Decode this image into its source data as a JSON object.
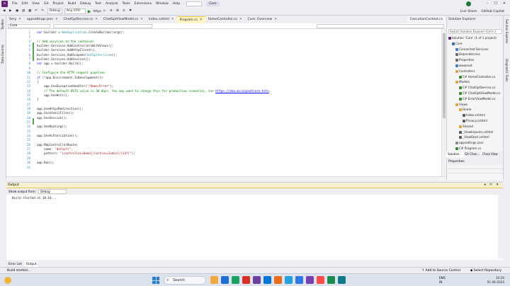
{
  "menu": {
    "items": [
      "File",
      "Edit",
      "View",
      "Git",
      "Project",
      "Build",
      "Debug",
      "Test",
      "Analyze",
      "Tools",
      "Extensions",
      "Window",
      "Help"
    ],
    "solution_badge": "Core",
    "avatar_initial": "S"
  },
  "toolbar": {
    "config": "Debug",
    "platform": "Any CPU",
    "run_target": "https",
    "live_share": "Live Share",
    "copilot": "GitHub Copilot"
  },
  "side_strips": {
    "left": [
      "Toolbox",
      "Data Sources"
    ],
    "right": [
      "Solution Explorer",
      "Diagnostic Tools"
    ]
  },
  "tabs": [
    {
      "label": "Sery",
      "active": false
    },
    {
      "label": "appsettings.json",
      "active": false
    },
    {
      "label": "ChatGptService.cs",
      "active": false
    },
    {
      "label": "ChatGptViewModel.cs",
      "active": false
    },
    {
      "label": "Index.cshtml",
      "active": false
    },
    {
      "label": "Program.cs",
      "active": true
    },
    {
      "label": "HomeController.cs",
      "active": false
    },
    {
      "label": "Core: Overview",
      "active": false
    }
  ],
  "right_tab": "ExecutionContext.cs",
  "navbar": {
    "project": "Core",
    "scope": ""
  },
  "code_lines": [
    {
      "n": "1",
      "html": "<span class=\"kw\">var</span> builder = <span class=\"ty\">WebApplication</span>.CreateBuilder(args);"
    },
    {
      "n": "2",
      "html": ""
    },
    {
      "n": "3",
      "html": "<span class=\"cm\">// Add services to the container.</span>"
    },
    {
      "n": "4",
      "html": "builder.Services.AddControllersWithViews();"
    },
    {
      "n": "5",
      "html": "builder.Services.AddHttpClient();"
    },
    {
      "n": "6",
      "html": "builder.Services.AddScoped&lt;<span class=\"ty\">ChatGptService</span>&gt;();"
    },
    {
      "n": "7",
      "html": "builder.Services.AddSession();"
    },
    {
      "n": "8",
      "html": "<span class=\"kw\">var</span> app = builder.Build();"
    },
    {
      "n": "9",
      "html": ""
    },
    {
      "n": "10",
      "html": "<span class=\"cm\">// Configure the HTTP request pipeline.</span>"
    },
    {
      "n": "11",
      "html": "<span class=\"kw\">if</span> (!app.Environment.IsDevelopment())"
    },
    {
      "n": "12",
      "html": "{"
    },
    {
      "n": "13",
      "html": "    app.UseExceptionHandler(<span class=\"st\">\"/Home/Error\"</span>);"
    },
    {
      "n": "14",
      "html": "    <span class=\"cm\">// The default HSTS value is 30 days. You may want to change this for production scenarios, see </span><span class=\"lk\">https://aka.ms/aspnetcore-hsts</span><span class=\"cm\">.</span>"
    },
    {
      "n": "15",
      "html": "    app.UseHsts();"
    },
    {
      "n": "16",
      "html": "}"
    },
    {
      "n": "17",
      "html": ""
    },
    {
      "n": "18",
      "html": "app.UseHttpsRedirection();"
    },
    {
      "n": "19",
      "html": "app.UseStaticFiles();"
    },
    {
      "n": "20",
      "html": "app.UseSession();"
    },
    {
      "n": "21",
      "html": ""
    },
    {
      "n": "22",
      "html": "app.UseRouting();"
    },
    {
      "n": "23",
      "html": ""
    },
    {
      "n": "24",
      "html": "app.UseAuthorization();"
    },
    {
      "n": "25",
      "html": ""
    },
    {
      "n": "26",
      "html": "app.MapControllerRoute("
    },
    {
      "n": "27",
      "html": "    name: <span class=\"st\">\"default\"</span>,"
    },
    {
      "n": "28",
      "html": "    pattern: <span class=\"st\">\"{controller=Home}/{action=Index}/{id?}\"</span>);"
    },
    {
      "n": "29",
      "html": ""
    },
    {
      "n": "30",
      "html": "app.Run();"
    },
    {
      "n": "31",
      "html": ""
    }
  ],
  "solution_explorer": {
    "title": "Solution Explorer",
    "search_placeholder": "Search Solution Explorer (Ctrl+;)",
    "items": [
      {
        "label": "Solution 'Core' (1 of 1 project)",
        "indent": 0,
        "color": "#68217a"
      },
      {
        "label": "Core",
        "indent": 1,
        "color": "#2b6cb0"
      },
      {
        "label": "Connected Services",
        "indent": 2,
        "color": "#3b7bd1"
      },
      {
        "label": "Dependencies",
        "indent": 2,
        "color": "#6b6b6b"
      },
      {
        "label": "Properties",
        "indent": 2,
        "color": "#6b6b6b"
      },
      {
        "label": "wwwroot",
        "indent": 2,
        "color": "#3b7bd1"
      },
      {
        "label": "Controllers",
        "indent": 2,
        "color": "#d8a93a"
      },
      {
        "label": "C# HomeController.cs",
        "indent": 3,
        "color": "#388a34"
      },
      {
        "label": "Models",
        "indent": 2,
        "color": "#d8a93a"
      },
      {
        "label": "C# ChatGptService.cs",
        "indent": 3,
        "color": "#388a34"
      },
      {
        "label": "C# ChatGptViewModel.cs",
        "indent": 3,
        "color": "#388a34"
      },
      {
        "label": "C# ErrorViewModel.cs",
        "indent": 3,
        "color": "#388a34"
      },
      {
        "label": "Views",
        "indent": 2,
        "color": "#d8a93a"
      },
      {
        "label": "Home",
        "indent": 3,
        "color": "#d8a93a"
      },
      {
        "label": "Index.cshtml",
        "indent": 4,
        "color": "#5a5a5a"
      },
      {
        "label": "Privacy.cshtml",
        "indent": 4,
        "color": "#5a5a5a"
      },
      {
        "label": "Shared",
        "indent": 3,
        "color": "#d8a93a"
      },
      {
        "label": "_ViewImports.cshtml",
        "indent": 3,
        "color": "#5a5a5a"
      },
      {
        "label": "_ViewStart.cshtml",
        "indent": 3,
        "color": "#5a5a5a"
      },
      {
        "label": "appsettings.json",
        "indent": 2,
        "color": "#8a8a8a"
      },
      {
        "label": "C# Program.cs",
        "indent": 2,
        "color": "#388a34"
      }
    ],
    "bottom_tabs": [
      "Solution...",
      "Git Chan...",
      "Class View"
    ]
  },
  "properties": {
    "title": "Properties"
  },
  "output": {
    "title": "Output",
    "show_output_from_label": "Show output from:",
    "show_output_from_value": "Debug",
    "text": "Build started at 10:10..."
  },
  "output_tabs": [
    "Error List",
    "Output"
  ],
  "statusbar": {
    "left": "Build started...",
    "source_control": "Add to Source Control",
    "repository": "Select Repository"
  },
  "taskbar": {
    "search": "Search",
    "lang": "ENG\nIN",
    "time": "10:26",
    "date": "01-06-2024",
    "app_colors": [
      "#f2a93b",
      "#1e6fd9",
      "#1aa260",
      "#d93025",
      "#6b3fa0",
      "#0078d4",
      "#e86c1a",
      "#24a1de",
      "#2c7be5",
      "#7a3fb0",
      "#ff4a4a",
      "#1d8a4e",
      "#0e7a8a"
    ]
  }
}
